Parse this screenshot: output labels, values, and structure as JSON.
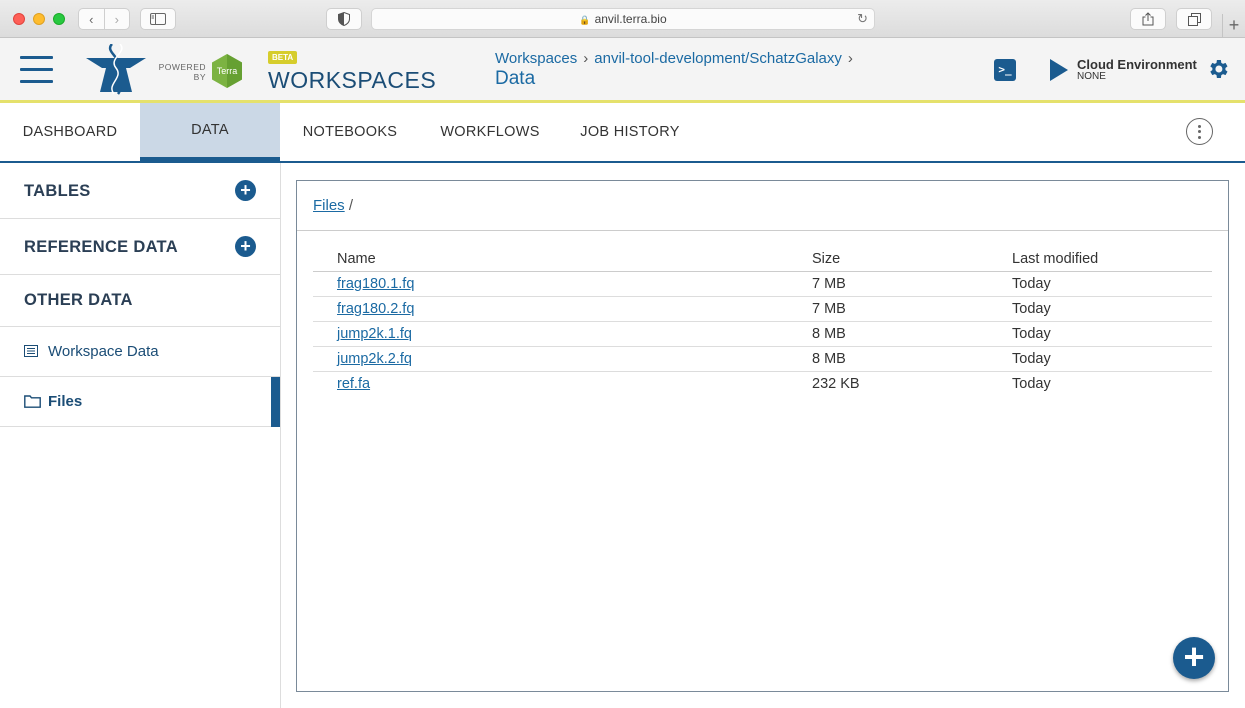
{
  "browser": {
    "url": "anvil.terra.bio"
  },
  "header": {
    "powered_by": "POWERED BY",
    "terra_logo": "Terra",
    "beta_badge": "BETA",
    "app_title": "WORKSPACES",
    "breadcrumb": [
      "Workspaces",
      "anvil-tool-development/SchatzGalaxy"
    ],
    "breadcrumb_sep": "›",
    "page_title": "Data",
    "terminal_glyph": ">_",
    "cloud_env_label": "Cloud Environment",
    "cloud_env_status": "NONE"
  },
  "tabs": [
    {
      "label": "DASHBOARD",
      "active": false
    },
    {
      "label": "DATA",
      "active": true
    },
    {
      "label": "NOTEBOOKS",
      "active": false
    },
    {
      "label": "WORKFLOWS",
      "active": false
    },
    {
      "label": "JOB HISTORY",
      "active": false
    }
  ],
  "sidebar": {
    "tables_label": "TABLES",
    "reference_label": "REFERENCE DATA",
    "other_label": "OTHER DATA",
    "items": [
      {
        "label": "Workspace Data",
        "icon": "list-icon",
        "active": false
      },
      {
        "label": "Files",
        "icon": "folder-icon",
        "active": true
      }
    ]
  },
  "files_panel": {
    "breadcrumb_root": "Files",
    "breadcrumb_sep": "/",
    "columns": [
      "Name",
      "Size",
      "Last modified"
    ],
    "rows": [
      {
        "name": "frag180.1.fq",
        "size": "7 MB",
        "modified": "Today"
      },
      {
        "name": "frag180.2.fq",
        "size": "7 MB",
        "modified": "Today"
      },
      {
        "name": "jump2k.1.fq",
        "size": "8 MB",
        "modified": "Today"
      },
      {
        "name": "jump2k.2.fq",
        "size": "8 MB",
        "modified": "Today"
      },
      {
        "name": "ref.fa",
        "size": "232 KB",
        "modified": "Today"
      }
    ]
  },
  "colors": {
    "primary": "#1b5b8f",
    "link": "#1b6aa3",
    "active_tab_bg": "#cbd8e6",
    "header_accent": "#e5e16c",
    "beta": "#d6cd2c",
    "terra_green": "#7cb342"
  }
}
